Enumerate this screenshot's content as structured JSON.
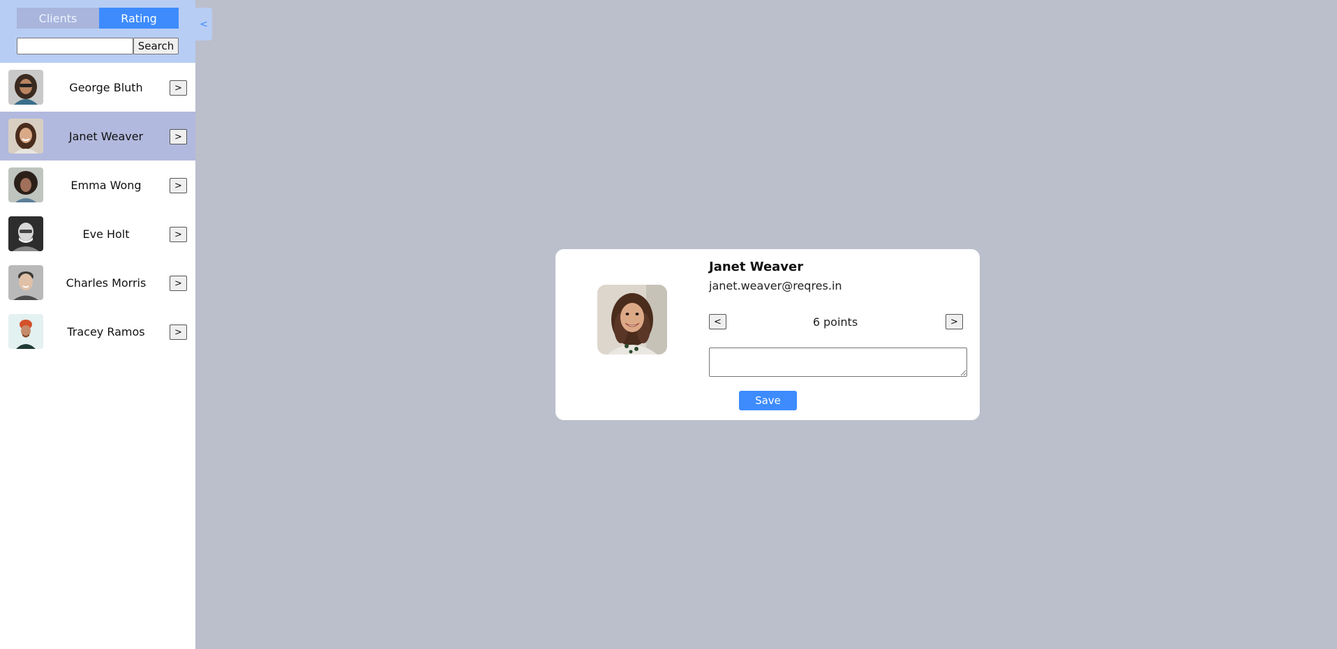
{
  "sidebar": {
    "tabs": [
      {
        "label": "Clients",
        "active": false
      },
      {
        "label": "Rating",
        "active": true
      }
    ],
    "search": {
      "placeholder": "",
      "value": "",
      "button_label": "Search"
    },
    "collapse_label": "<",
    "clients": [
      {
        "name": "George Bluth",
        "go_label": ">",
        "selected": false
      },
      {
        "name": "Janet Weaver",
        "go_label": ">",
        "selected": true
      },
      {
        "name": "Emma Wong",
        "go_label": ">",
        "selected": false
      },
      {
        "name": "Eve Holt",
        "go_label": ">",
        "selected": false
      },
      {
        "name": "Charles Morris",
        "go_label": ">",
        "selected": false
      },
      {
        "name": "Tracey Ramos",
        "go_label": ">",
        "selected": false
      }
    ]
  },
  "detail": {
    "name": "Janet Weaver",
    "email": "janet.weaver@reqres.in",
    "points": 6,
    "points_unit": "points",
    "prev_label": "<",
    "next_label": ">",
    "comment": "",
    "save_label": "Save"
  },
  "colors": {
    "background": "#bbbfcc",
    "sidebar_header": "#b7cdf4",
    "tab_active": "#3d8bfd",
    "tab_inactive": "#a9b5dc",
    "selected_row": "#b2b9de",
    "save_button": "#3d8bfd"
  }
}
